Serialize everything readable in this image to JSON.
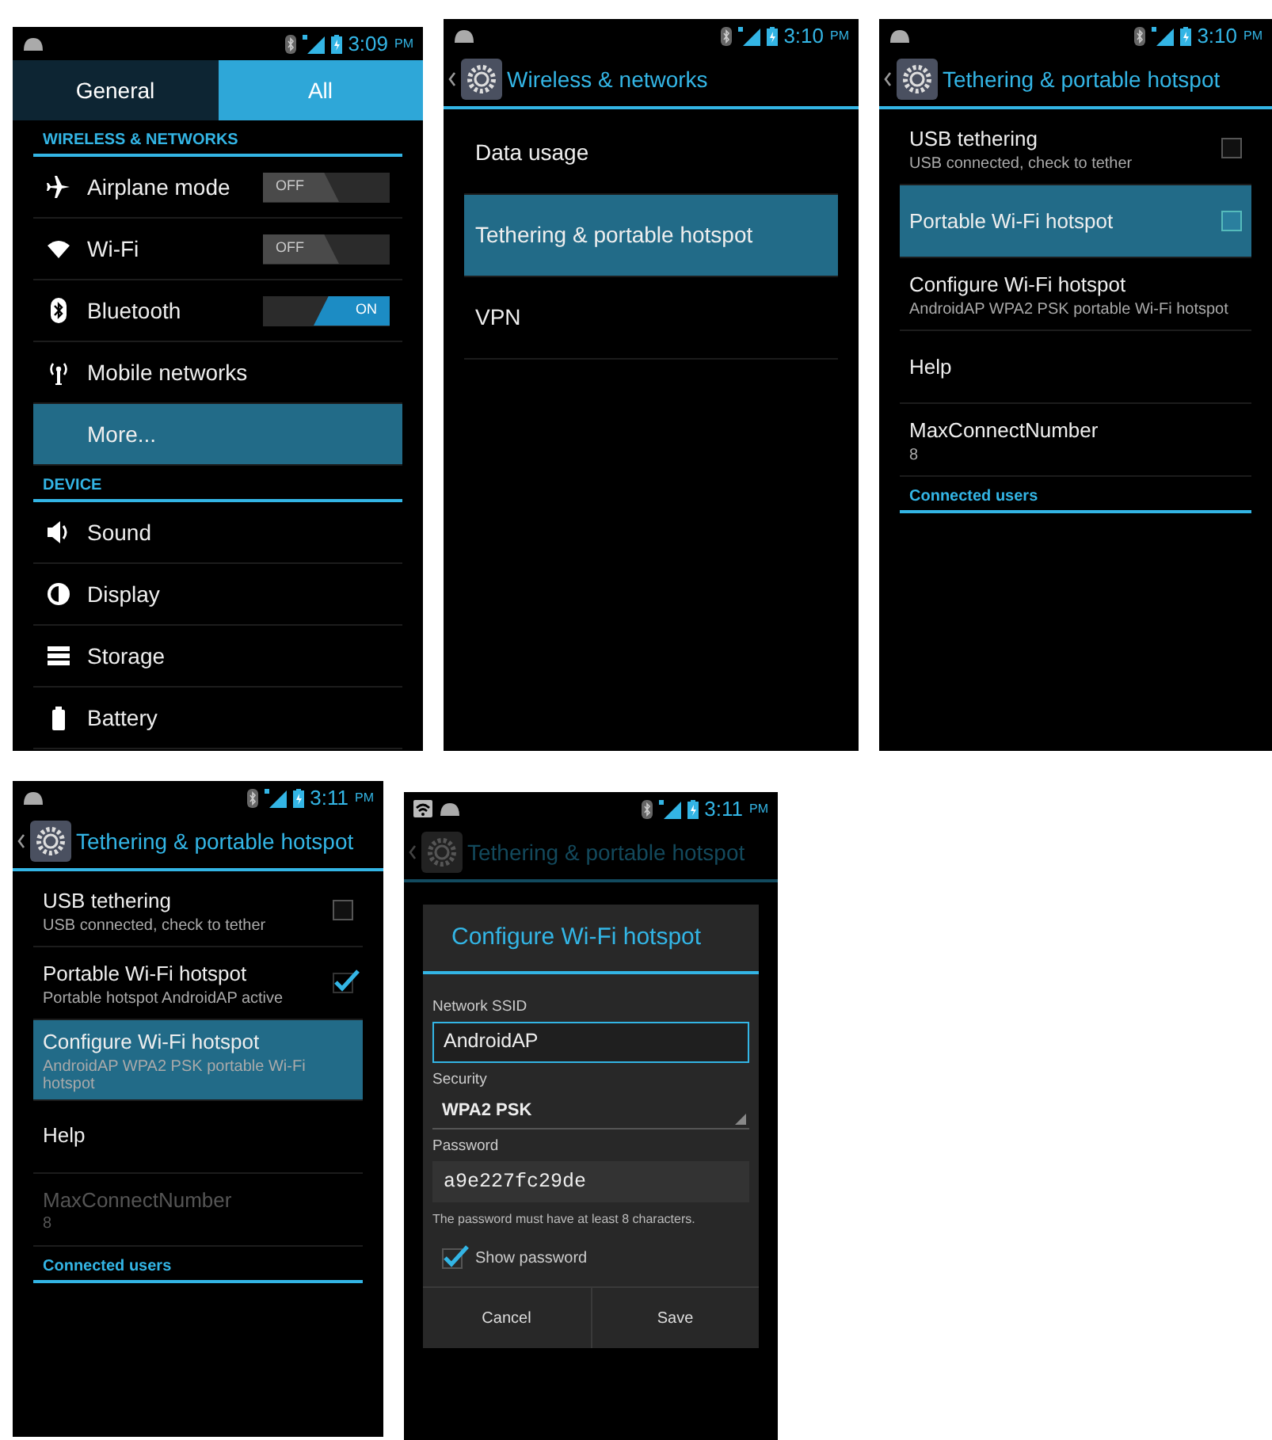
{
  "screens": [
    {
      "kind": "tabbed",
      "status_bar": {
        "time": "3:09",
        "period": "PM",
        "hotspot_icon": false
      },
      "tabs": [
        {
          "label": "General",
          "selected": false
        },
        {
          "label": "All",
          "selected": true
        }
      ],
      "sections": [
        {
          "header": "WIRELESS & NETWORKS",
          "items": [
            {
              "label": "Airplane mode",
              "switch": {
                "text": "OFF",
                "on": false
              },
              "selected": false
            },
            {
              "label": "Wi-Fi",
              "switch": {
                "text": "OFF",
                "on": false
              },
              "selected": false
            },
            {
              "label": "Bluetooth",
              "switch": {
                "text": "ON",
                "on": true
              },
              "selected": false
            },
            {
              "label": "Mobile networks",
              "selected": false
            },
            {
              "label": "More...",
              "selected": true
            }
          ]
        },
        {
          "header": "DEVICE",
          "items": [
            {
              "label": "Sound",
              "selected": false
            },
            {
              "label": "Display",
              "selected": false
            },
            {
              "label": "Storage",
              "selected": false
            },
            {
              "label": "Battery",
              "selected": false
            }
          ]
        }
      ]
    },
    {
      "kind": "list",
      "status_bar": {
        "time": "3:10",
        "period": "PM",
        "hotspot_icon": false
      },
      "title": "Wireless & networks",
      "items": [
        {
          "label": "Data usage",
          "selected": false
        },
        {
          "label": "Tethering & portable hotspot",
          "selected": true
        },
        {
          "label": "VPN",
          "selected": false
        }
      ]
    },
    {
      "kind": "list",
      "status_bar": {
        "time": "3:10",
        "period": "PM",
        "hotspot_icon": false
      },
      "title": "Tethering & portable hotspot",
      "items": [
        {
          "label": "USB tethering",
          "summary": "USB connected, check to tether",
          "checkbox": {
            "checked": false
          },
          "selected": false,
          "disabled": false
        },
        {
          "label": "Portable Wi-Fi hotspot",
          "checkbox": {
            "checked": false
          },
          "selected": true,
          "disabled": false
        },
        {
          "label": "Configure Wi-Fi hotspot",
          "summary": "AndroidAP WPA2 PSK portable Wi-Fi hotspot",
          "selected": false,
          "disabled": false
        },
        {
          "label": "Help",
          "selected": false,
          "disabled": false
        },
        {
          "label": "MaxConnectNumber",
          "summary": "8",
          "selected": false,
          "disabled": false
        }
      ],
      "section_header": "Connected users"
    },
    {
      "kind": "list",
      "status_bar": {
        "time": "3:11",
        "period": "PM",
        "hotspot_icon": false
      },
      "title": "Tethering & portable hotspot",
      "items": [
        {
          "label": "USB tethering",
          "summary": "USB connected, check to tether",
          "checkbox": {
            "checked": false
          },
          "selected": false,
          "disabled": false
        },
        {
          "label": "Portable Wi-Fi hotspot",
          "summary": "Portable hotspot AndroidAP active",
          "checkbox": {
            "checked": true
          },
          "selected": false,
          "disabled": false
        },
        {
          "label": "Configure Wi-Fi hotspot",
          "summary": "AndroidAP WPA2 PSK portable Wi-Fi hotspot",
          "selected": true,
          "disabled": false
        },
        {
          "label": "Help",
          "selected": false,
          "disabled": false
        },
        {
          "label": "MaxConnectNumber",
          "summary": "8",
          "selected": false,
          "disabled": true
        }
      ],
      "section_header": "Connected users"
    },
    {
      "kind": "dialog",
      "status_bar": {
        "time": "3:11",
        "period": "PM",
        "hotspot_icon": true
      },
      "title": "Tethering & portable hotspot",
      "dialog": {
        "title": "Configure Wi-Fi hotspot",
        "fields": [
          {
            "kind": "text",
            "label": "Network SSID",
            "value": "AndroidAP",
            "focused": true
          },
          {
            "kind": "select",
            "label": "Security",
            "value": "WPA2 PSK"
          },
          {
            "kind": "password",
            "label": "Password",
            "value": "a9e227fc29de",
            "focused": false
          }
        ],
        "hint": "The password must have at least 8 characters.",
        "checkbox": {
          "label": "Show password",
          "checked": true
        },
        "buttons": [
          "Cancel",
          "Save"
        ]
      }
    }
  ]
}
